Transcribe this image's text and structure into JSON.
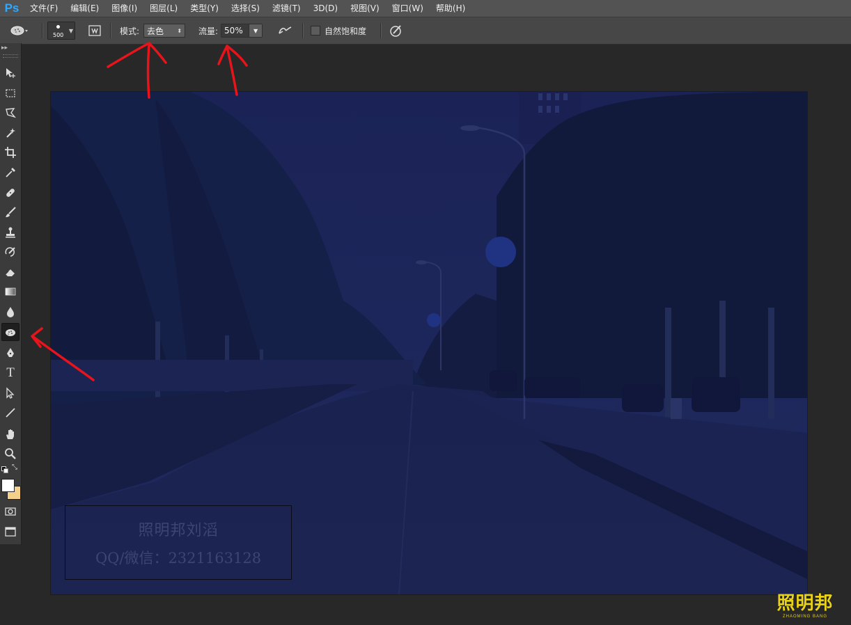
{
  "app": {
    "logo": "Ps"
  },
  "menu": [
    "文件(F)",
    "编辑(E)",
    "图像(I)",
    "图层(L)",
    "类型(Y)",
    "选择(S)",
    "滤镜(T)",
    "3D(D)",
    "视图(V)",
    "窗口(W)",
    "帮助(H)"
  ],
  "options": {
    "brush_size": "500",
    "mode_label": "模式:",
    "mode_value": "去色",
    "flow_label": "流量:",
    "flow_value": "50%",
    "natural_saturation_label": "自然饱和度",
    "natural_saturation_checked": false
  },
  "tools": [
    {
      "name": "move-tool",
      "icon": "move-icon"
    },
    {
      "name": "marquee-tool",
      "icon": "rect-marquee-icon"
    },
    {
      "name": "lasso-tool",
      "icon": "polygon-lasso-icon"
    },
    {
      "name": "magic-wand-tool",
      "icon": "magic-wand-icon"
    },
    {
      "name": "crop-tool",
      "icon": "crop-icon"
    },
    {
      "name": "eyedropper-tool",
      "icon": "eyedropper-icon"
    },
    {
      "name": "healing-brush-tool",
      "icon": "bandage-icon"
    },
    {
      "name": "brush-tool",
      "icon": "brush-icon"
    },
    {
      "name": "clone-stamp-tool",
      "icon": "stamp-icon"
    },
    {
      "name": "history-brush-tool",
      "icon": "history-brush-icon"
    },
    {
      "name": "eraser-tool",
      "icon": "eraser-icon"
    },
    {
      "name": "gradient-tool",
      "icon": "gradient-icon"
    },
    {
      "name": "blur-tool",
      "icon": "drop-icon"
    },
    {
      "name": "sponge-tool",
      "icon": "sponge-icon",
      "active": true
    },
    {
      "name": "pen-tool",
      "icon": "pen-icon"
    },
    {
      "name": "type-tool",
      "icon": "type-icon"
    },
    {
      "name": "path-selection-tool",
      "icon": "arrow-icon"
    },
    {
      "name": "line-tool",
      "icon": "line-icon"
    },
    {
      "name": "hand-tool",
      "icon": "hand-icon"
    },
    {
      "name": "zoom-tool",
      "icon": "zoom-icon"
    }
  ],
  "type_tool_glyph": "T",
  "colors": {
    "foreground": "#ffffff",
    "background": "#f5d08c",
    "annotation": "#e8141b",
    "photo_tint": "#141c4a"
  },
  "watermark": {
    "line1": "照明邦刘滔",
    "line2": "QQ/微信：2321163128"
  },
  "brand": {
    "name": "照明邦",
    "pinyin": "ZHAOMING BANG"
  }
}
